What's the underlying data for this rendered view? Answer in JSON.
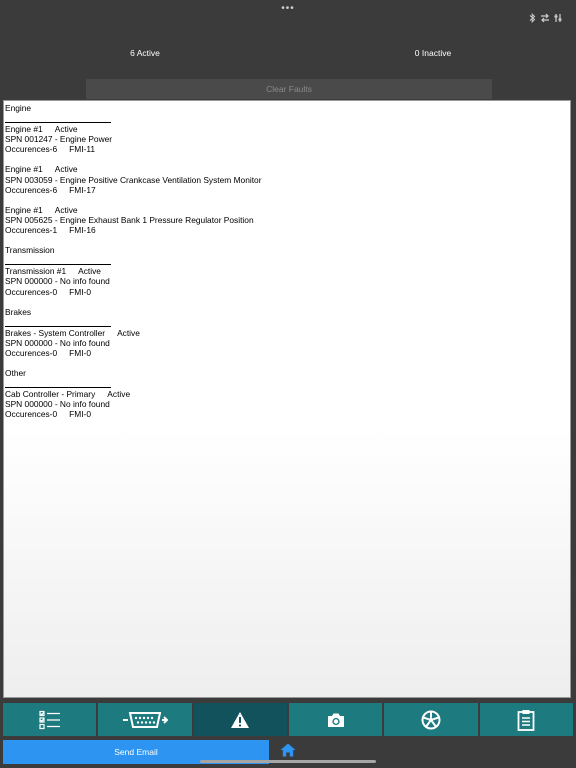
{
  "top": {
    "dots": "•••"
  },
  "summary": {
    "active": "6 Active",
    "inactive": "0 Inactive"
  },
  "actions": {
    "clear_faults": "Clear Faults",
    "send_email": "Send Email"
  },
  "sections": [
    {
      "title": "Engine",
      "entries": [
        {
          "source": "Engine #1",
          "status": "Active",
          "spn": "SPN 001247 - Engine Power",
          "occ": "Occurences-6",
          "fmi": "FMI-11"
        },
        {
          "source": "Engine #1",
          "status": "Active",
          "spn": "SPN 003059 - Engine Positive Crankcase Ventilation System Monitor",
          "occ": "Occurences-6",
          "fmi": "FMI-17"
        },
        {
          "source": "Engine #1",
          "status": "Active",
          "spn": "SPN 005625 - Engine Exhaust Bank 1 Pressure Regulator Position",
          "occ": "Occurences-1",
          "fmi": "FMI-16"
        }
      ]
    },
    {
      "title": "Transmission",
      "entries": [
        {
          "source": "Transmission #1",
          "status": "Active",
          "spn": "SPN 000000 - No info found",
          "occ": "Occurences-0",
          "fmi": "FMI-0"
        }
      ]
    },
    {
      "title": "Brakes",
      "entries": [
        {
          "source": "Brakes - System Controller",
          "status": "Active",
          "spn": "SPN 000000 - No info found",
          "occ": "Occurences-0",
          "fmi": "FMI-0"
        }
      ]
    },
    {
      "title": "Other",
      "entries": [
        {
          "source": "Cab Controller - Primary",
          "status": "Active",
          "spn": "SPN 000000 - No info found",
          "occ": "Occurences-0",
          "fmi": "FMI-0"
        }
      ]
    }
  ],
  "tabs": [
    {
      "icon": "checklist-icon",
      "selected": false
    },
    {
      "icon": "obd-connector-icon",
      "selected": false
    },
    {
      "icon": "warning-icon",
      "selected": true
    },
    {
      "icon": "camera-icon",
      "selected": false
    },
    {
      "icon": "wheel-icon",
      "selected": false
    },
    {
      "icon": "clipboard-icon",
      "selected": false
    }
  ],
  "colors": {
    "background": "#3b3b3b",
    "tab": "#1d7a7f",
    "tab_selected": "#11525d",
    "email_button": "#2d95f1",
    "home_icon": "#2d95f1"
  }
}
